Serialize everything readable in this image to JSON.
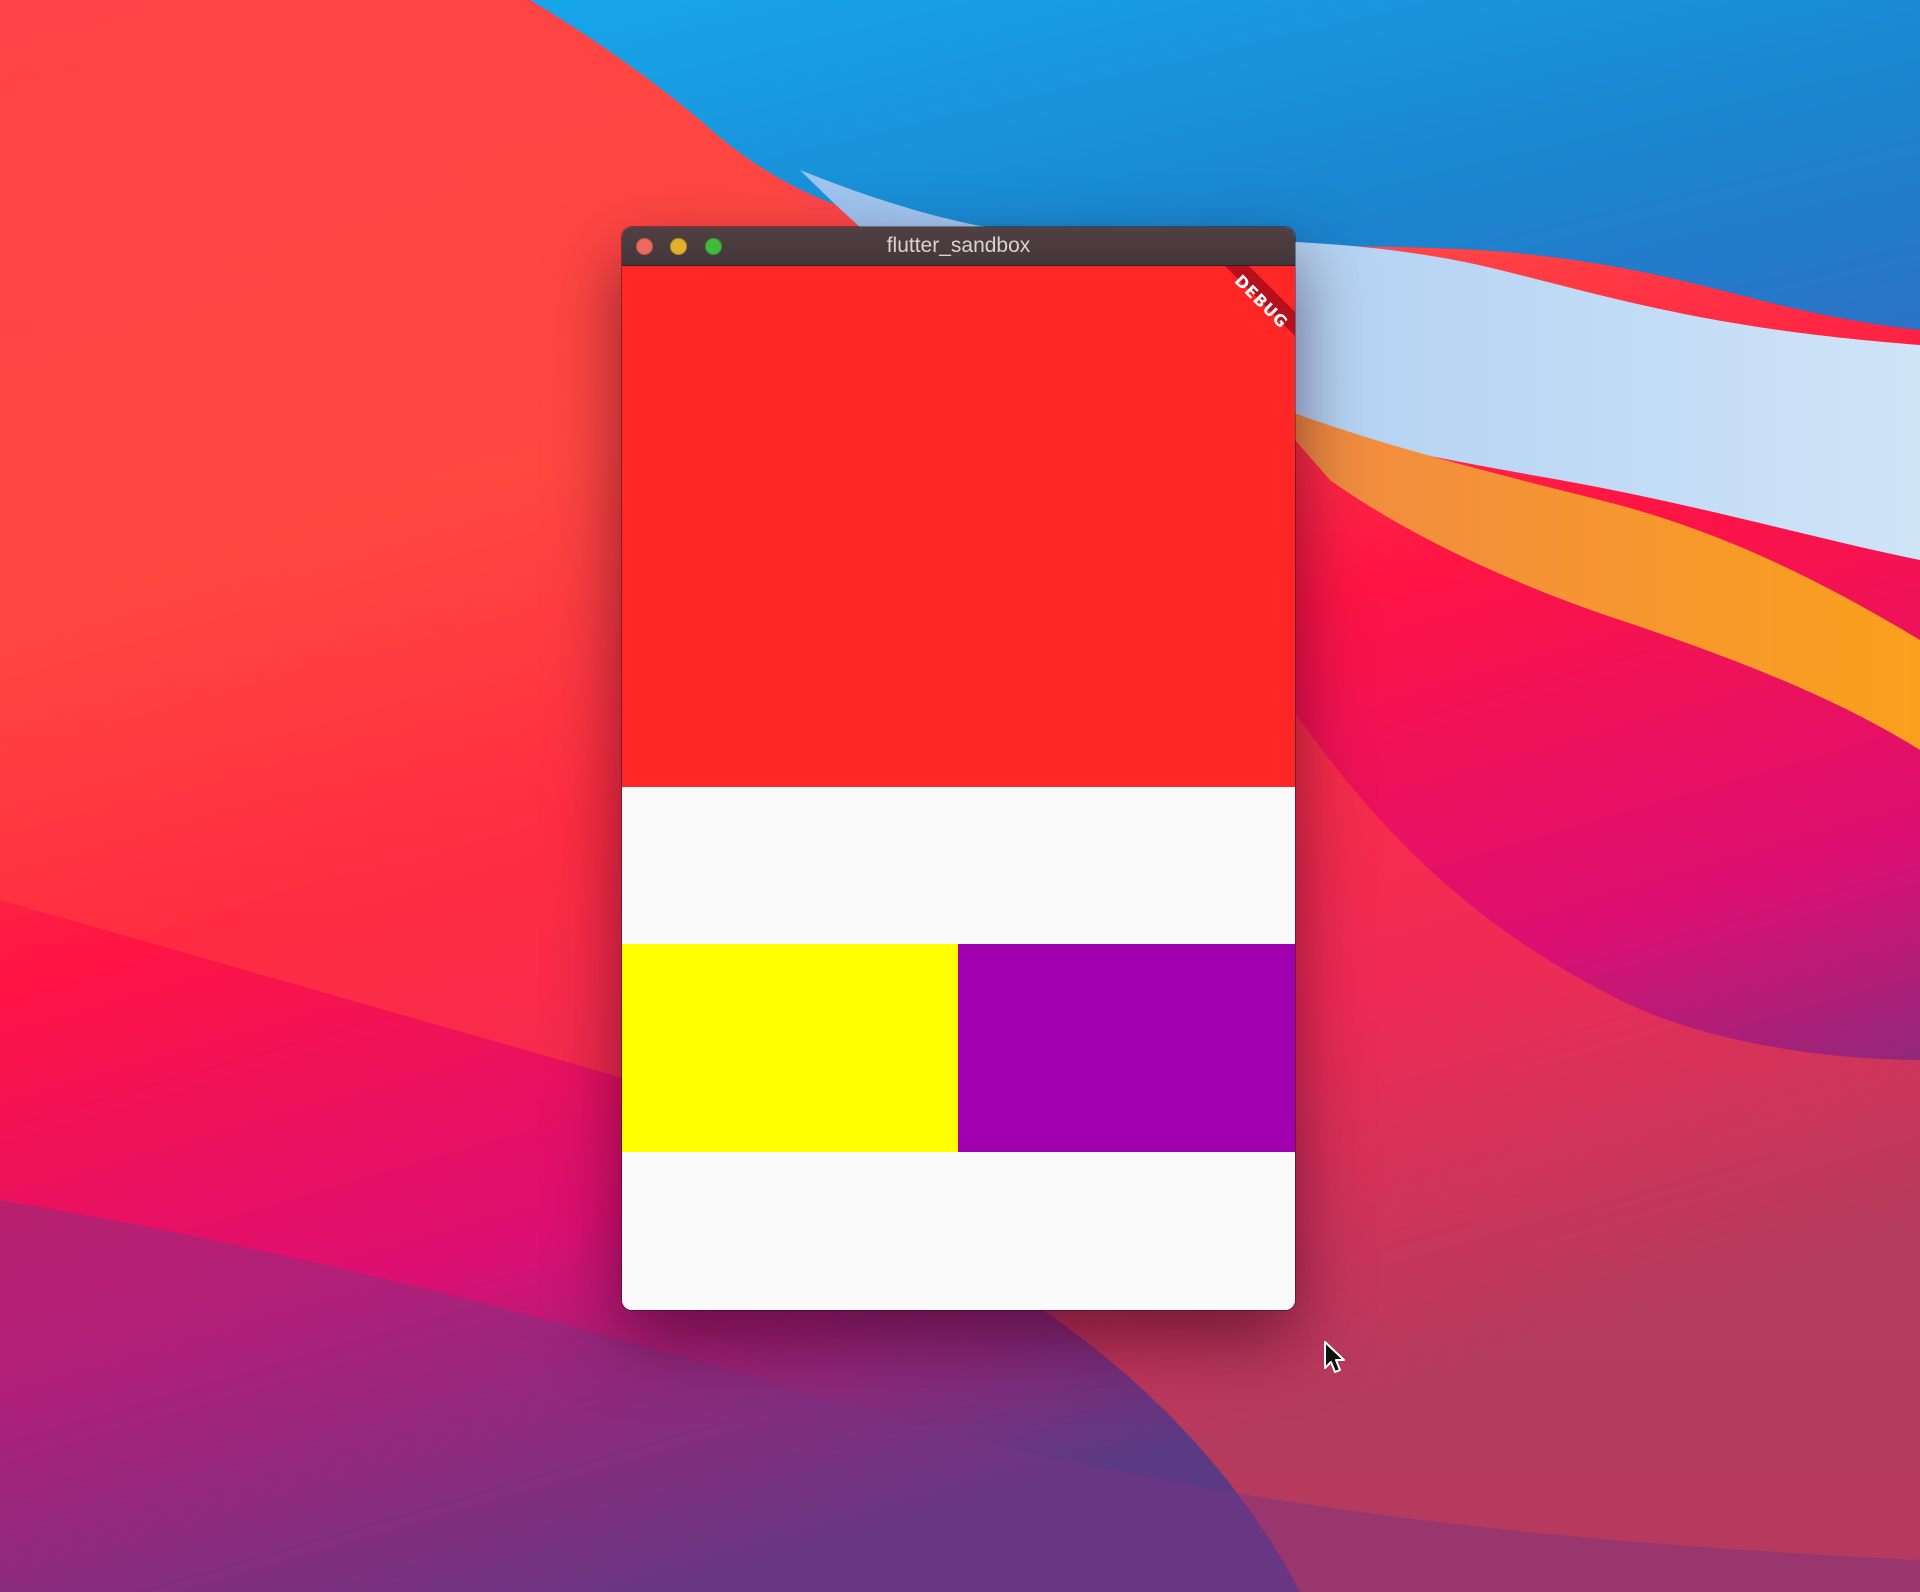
{
  "window": {
    "title": "flutter_sandbox"
  },
  "app": {
    "debug_banner": "DEBUG",
    "colors": {
      "top_block": "#ff2626",
      "bottom_left_block": "#ffff00",
      "bottom_right_block": "#a100b0",
      "background": "#fafafa",
      "debug_banner": "#b80f1d"
    }
  },
  "desktop": {
    "wallpaper": "macOS Big Sur"
  }
}
